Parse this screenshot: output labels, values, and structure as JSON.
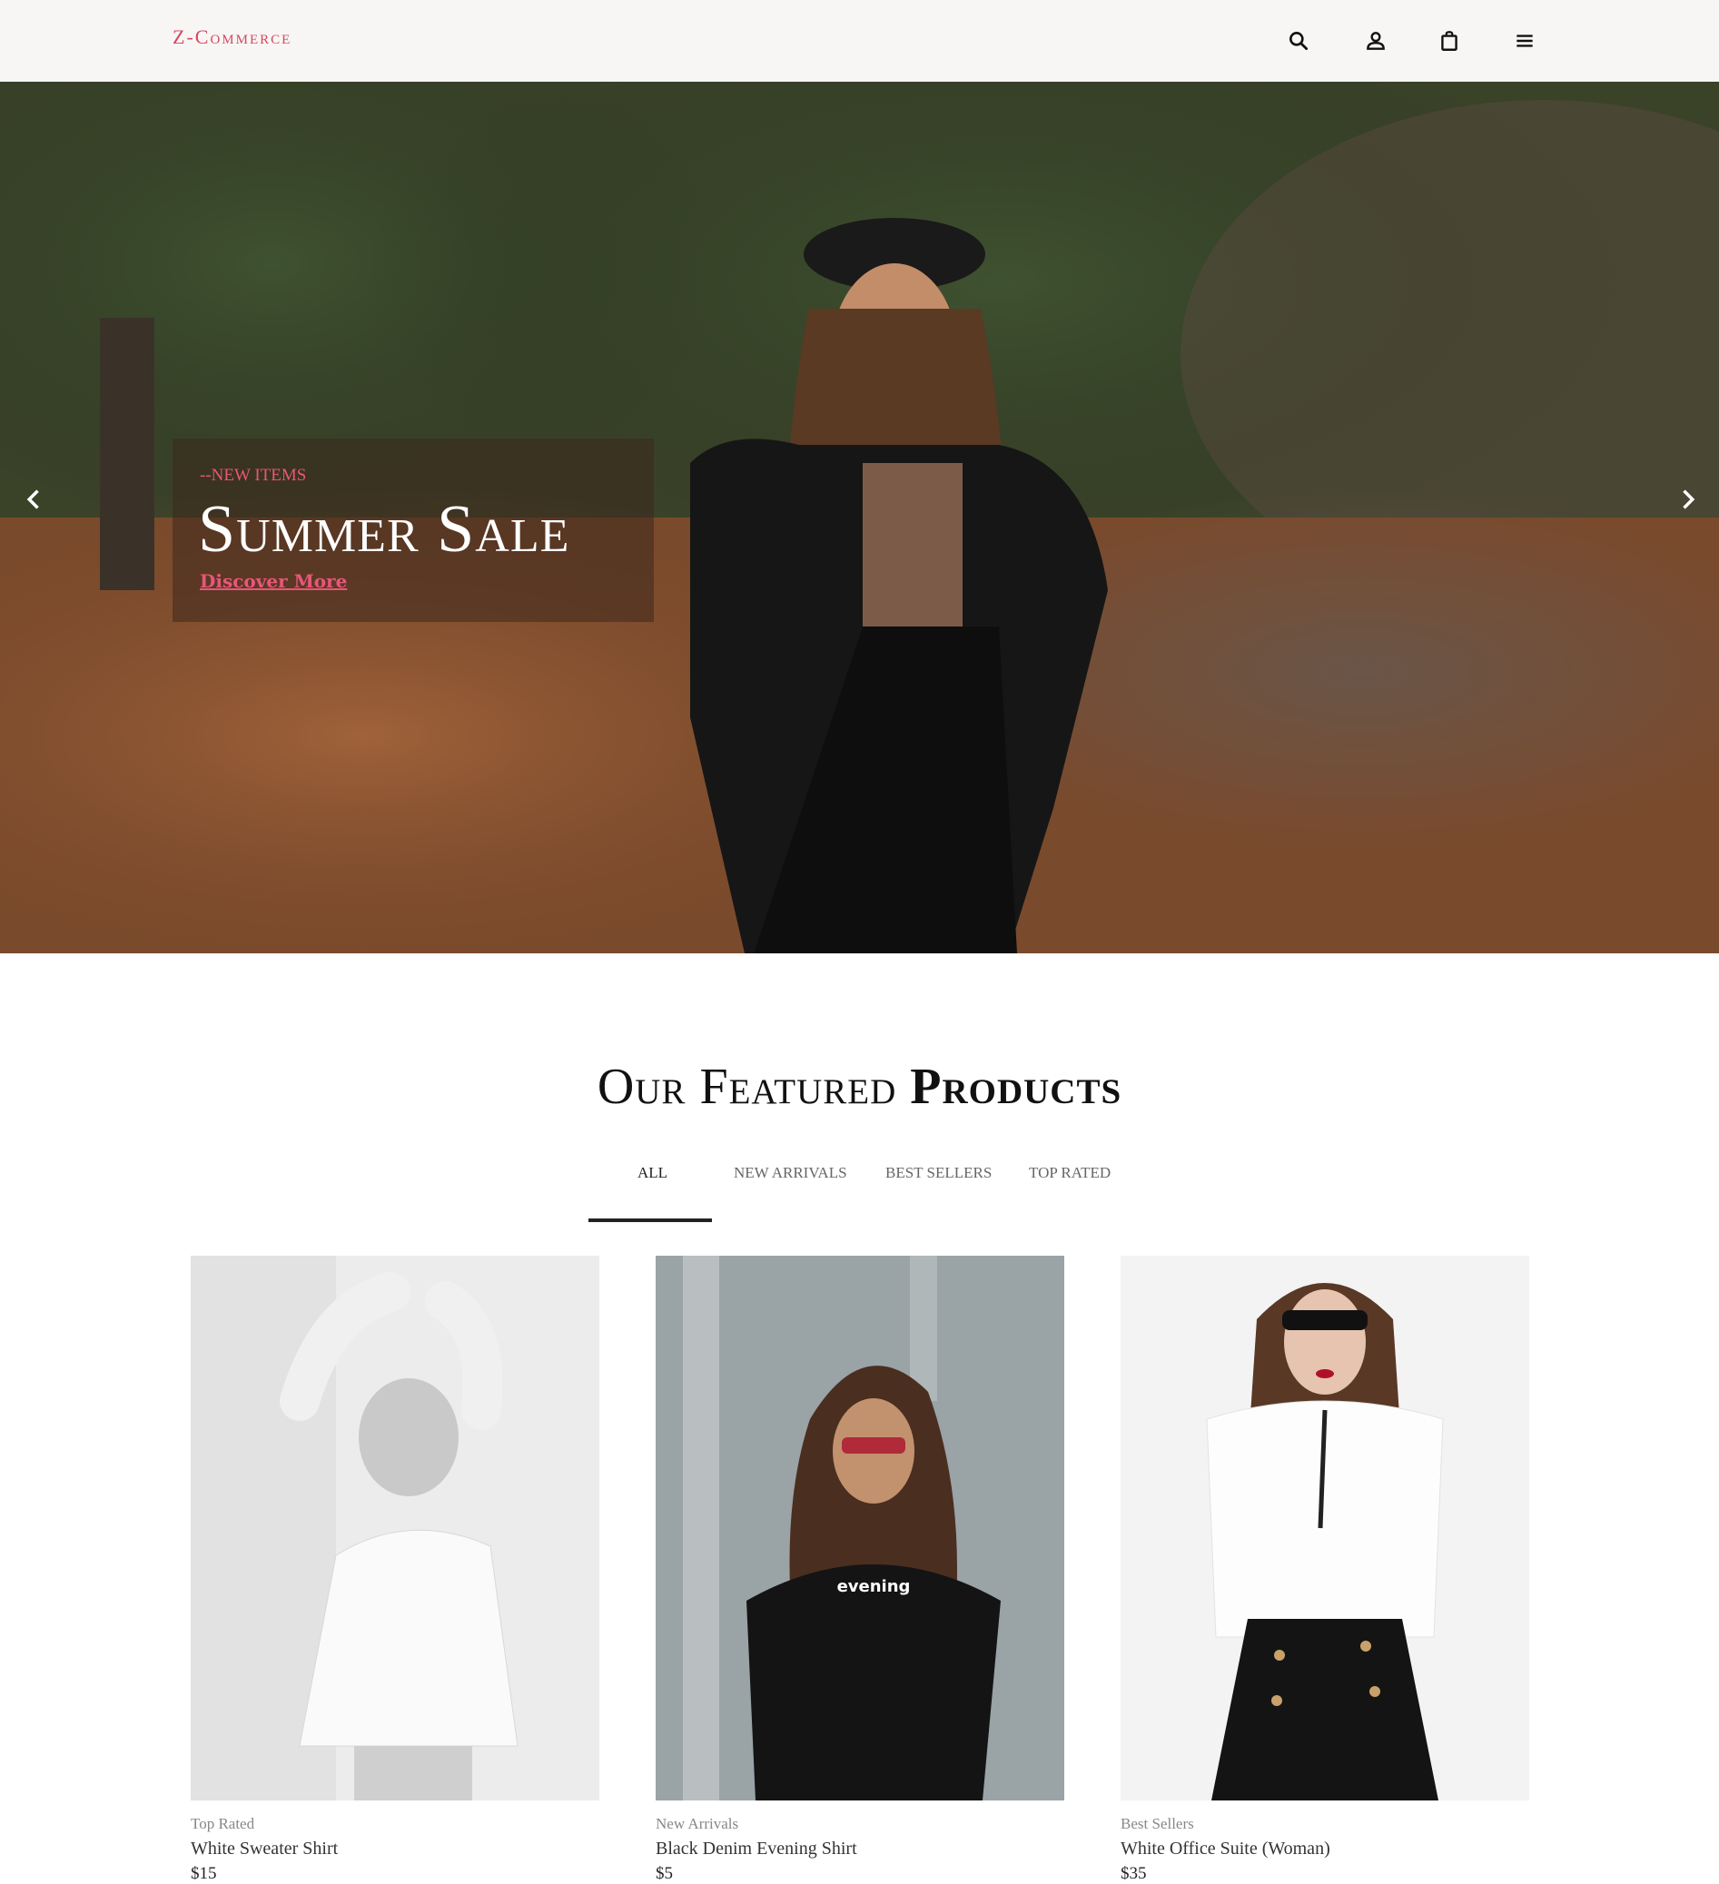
{
  "header": {
    "logo": "Z-Commerce",
    "icons": [
      "search-icon",
      "user-icon",
      "shopping-bag-icon",
      "menu-icon"
    ]
  },
  "hero": {
    "kicker": "--NEW ITEMS",
    "title": "Summer Sale",
    "link": "Discover More",
    "accent_color": "#e8567a"
  },
  "featured": {
    "title_light": "Our Featured",
    "title_bold": "Products",
    "tabs": [
      {
        "label": "ALL",
        "active": true
      },
      {
        "label": "NEW ARRIVALS",
        "active": false
      },
      {
        "label": "BEST SELLERS",
        "active": false
      },
      {
        "label": "TOP RATED",
        "active": false
      }
    ],
    "products": [
      {
        "category": "Top Rated",
        "name": "White Sweater Shirt",
        "price": "$15"
      },
      {
        "category": "New Arrivals",
        "name": "Black Denim Evening Shirt",
        "price": "$5"
      },
      {
        "category": "Best Sellers",
        "name": "White Office Suite (Woman)",
        "price": "$35"
      }
    ]
  },
  "colors": {
    "logo": "#d9455f",
    "accent": "#e8567a",
    "text_dark": "#222222"
  }
}
